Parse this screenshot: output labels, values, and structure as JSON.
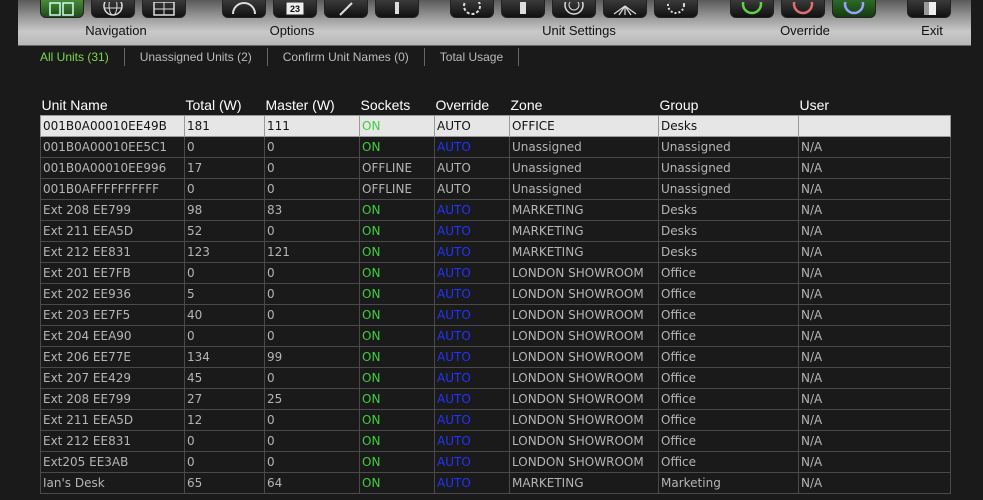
{
  "toolbar": {
    "groups": [
      {
        "label": "Navigation"
      },
      {
        "label": "Options",
        "calendar_day": "23"
      },
      {
        "label": "Unit Settings"
      },
      {
        "label": "Override"
      },
      {
        "label": "Exit"
      }
    ]
  },
  "tabs": [
    {
      "label": "All Units (31)",
      "active": true
    },
    {
      "label": "Unassigned Units (2)",
      "active": false
    },
    {
      "label": "Confirm Unit Names (0)",
      "active": false
    },
    {
      "label": "Total Usage",
      "active": false
    }
  ],
  "table": {
    "columns": [
      "Unit Name",
      "Total (W)",
      "Master (W)",
      "Sockets",
      "Override",
      "Zone",
      "Group",
      "User"
    ],
    "rows": [
      [
        "001B0A00010EE49B",
        "181",
        "111",
        "ON",
        "AUTO",
        "OFFICE",
        "Desks",
        ""
      ],
      [
        "001B0A00010EE5C1",
        "0",
        "0",
        "ON",
        "AUTO",
        "Unassigned",
        "Unassigned",
        "N/A"
      ],
      [
        "001B0A00010EE996",
        "17",
        "0",
        "OFFLINE",
        "AUTO",
        "Unassigned",
        "Unassigned",
        "N/A"
      ],
      [
        "001B0AFFFFFFFFFF",
        "0",
        "0",
        "OFFLINE",
        "AUTO",
        "Unassigned",
        "Unassigned",
        "N/A"
      ],
      [
        "Ext 208 EE799",
        "98",
        "83",
        "ON",
        "AUTO",
        "MARKETING",
        "Desks",
        "N/A"
      ],
      [
        "Ext 211 EEA5D",
        "52",
        "0",
        "ON",
        "AUTO",
        "MARKETING",
        "Desks",
        "N/A"
      ],
      [
        "Ext 212 EE831",
        "123",
        "121",
        "ON",
        "AUTO",
        "MARKETING",
        "Desks",
        "N/A"
      ],
      [
        "Ext 201 EE7FB",
        "0",
        "0",
        "ON",
        "AUTO",
        "LONDON SHOWROOM",
        "Office",
        "N/A"
      ],
      [
        "Ext 202 EE936",
        "5",
        "0",
        "ON",
        "AUTO",
        "LONDON SHOWROOM",
        "Office",
        "N/A"
      ],
      [
        "Ext 203 EE7F5",
        "40",
        "0",
        "ON",
        "AUTO",
        "LONDON SHOWROOM",
        "Office",
        "N/A"
      ],
      [
        "Ext 204 EEA90",
        "0",
        "0",
        "ON",
        "AUTO",
        "LONDON SHOWROOM",
        "Office",
        "N/A"
      ],
      [
        "Ext 206 EE77E",
        "134",
        "99",
        "ON",
        "AUTO",
        "LONDON SHOWROOM",
        "Office",
        "N/A"
      ],
      [
        "Ext 207 EE429",
        "45",
        "0",
        "ON",
        "AUTO",
        "LONDON SHOWROOM",
        "Office",
        "N/A"
      ],
      [
        "Ext 208 EE799",
        "27",
        "25",
        "ON",
        "AUTO",
        "LONDON SHOWROOM",
        "Office",
        "N/A"
      ],
      [
        "Ext 211 EEA5D",
        "12",
        "0",
        "ON",
        "AUTO",
        "LONDON SHOWROOM",
        "Office",
        "N/A"
      ],
      [
        "Ext 212 EE831",
        "0",
        "0",
        "ON",
        "AUTO",
        "LONDON SHOWROOM",
        "Office",
        "N/A"
      ],
      [
        "Ext205 EE3AB",
        "0",
        "0",
        "ON",
        "AUTO",
        "LONDON SHOWROOM",
        "Office",
        "N/A"
      ],
      [
        "Ian's Desk",
        "65",
        "64",
        "ON",
        "AUTO",
        "MARKETING",
        "Marketing",
        "N/A"
      ]
    ]
  },
  "colors": {
    "accent_green": "#7fd84a",
    "status_on": "#3ad13a",
    "override_auto": "#2233ff"
  }
}
